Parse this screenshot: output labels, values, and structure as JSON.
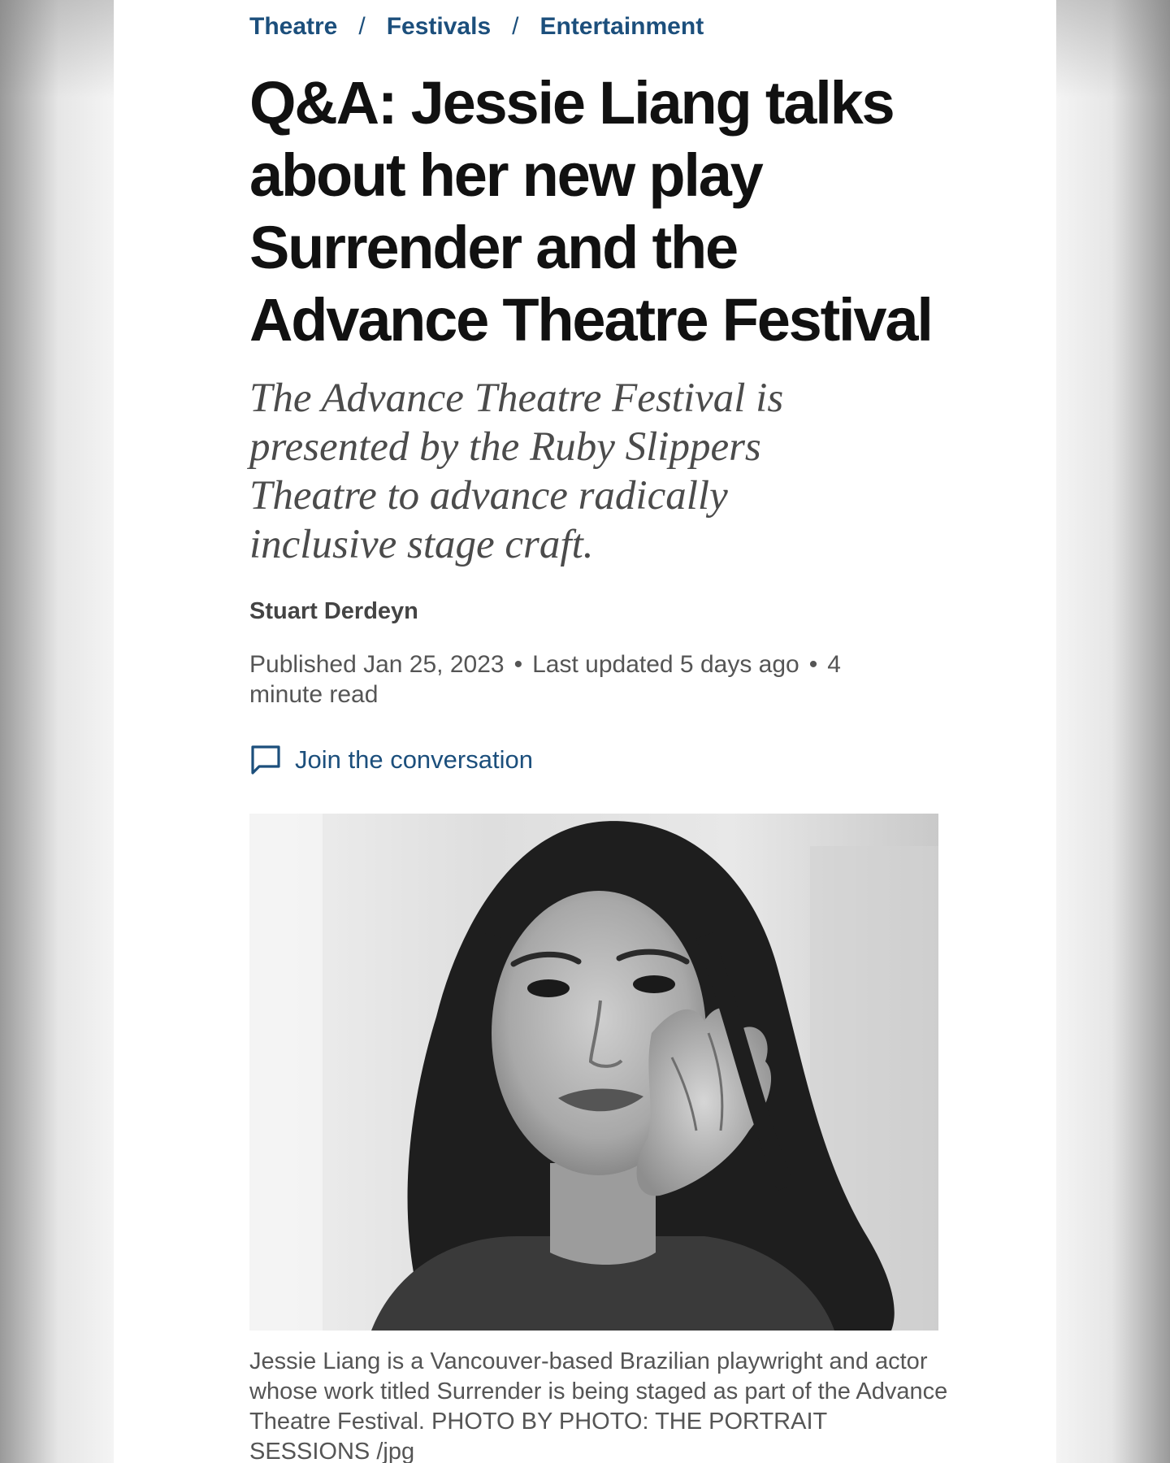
{
  "breadcrumb": {
    "items": [
      "Theatre",
      "Festivals",
      "Entertainment"
    ],
    "separator": "/"
  },
  "article": {
    "headline": "Q&A: Jessie Liang talks about her new play Surrender and the Advance Theatre Festival",
    "deck": "The Advance Theatre Festival is presented by the Ruby Slippers Theatre to advance radically inclusive stage craft.",
    "author": "Stuart Derdeyn",
    "published": "Published Jan 25, 2023",
    "updated": "Last updated 5 days ago",
    "read_time": "4 minute read",
    "meta_separator": "•",
    "conversation_link": "Join the conversation",
    "photo_caption": "Jessie Liang is a Vancouver-based Brazilian playwright and actor whose work titled Surrender is being staged as part of the Advance Theatre Festival. PHOTO BY PHOTO: THE PORTRAIT SESSIONS /jpg"
  },
  "colors": {
    "link": "#1c4f7c",
    "headline": "#111111",
    "deck": "#4b4b4b",
    "meta": "#555555"
  },
  "icons": {
    "conversation": "comment-bubble-icon"
  }
}
